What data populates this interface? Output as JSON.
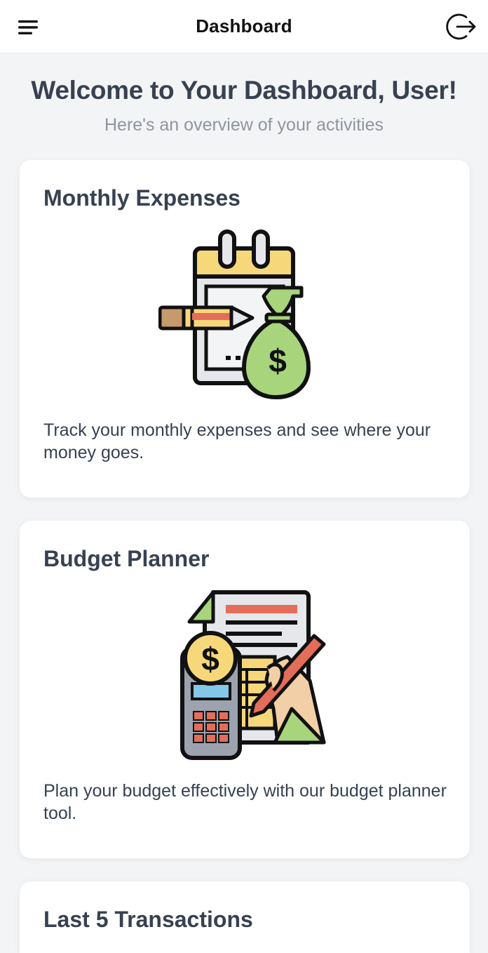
{
  "header": {
    "title": "Dashboard",
    "menu_icon": "hamburger-menu-icon",
    "logout_icon": "logout-icon"
  },
  "welcome": {
    "title": "Welcome to Your Dashboard, User!",
    "subtitle": "Here's an overview of your activities"
  },
  "cards": [
    {
      "title": "Monthly Expenses",
      "description": "Track your monthly expenses and see where your money goes.",
      "icon": "calendar-money-bag-icon"
    },
    {
      "title": "Budget Planner",
      "description": "Plan your budget effectively with our budget planner tool.",
      "icon": "budget-calculator-document-icon"
    },
    {
      "title": "Last 5 Transactions"
    }
  ],
  "colors": {
    "background": "#f3f4f6",
    "card": "#ffffff",
    "heading": "#374151",
    "subtext": "#8f959e",
    "illus_yellow": "#f6d77a",
    "illus_green": "#a8d57b",
    "illus_red": "#e46d5a",
    "illus_blue": "#85c7e8"
  }
}
